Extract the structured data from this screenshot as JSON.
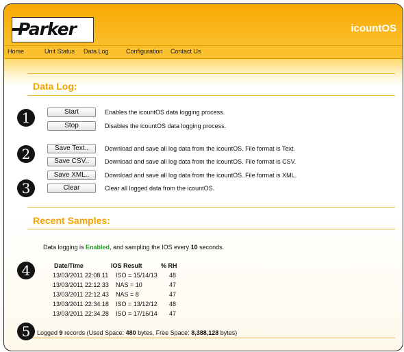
{
  "header": {
    "logo_text": "Parker",
    "app_title": "icountOS",
    "brand_color": "#f7a800"
  },
  "nav": {
    "items": [
      "Home",
      "Unit Status",
      "Data Log",
      "Configuration",
      "Contact Us"
    ]
  },
  "data_log": {
    "title": "Data Log:",
    "actions": [
      {
        "label": "Start",
        "description": "Enables the icountOS data logging process."
      },
      {
        "label": "Stop",
        "description": "Disables the icountOS data logging process."
      },
      {
        "label": "Save Text..",
        "description": "Download and save all log data from the icountOS. File format is Text."
      },
      {
        "label": "Save CSV..",
        "description": "Download and save all log data from the icountOS. File format is CSV."
      },
      {
        "label": "Save XML..",
        "description": "Download and save all log data from the icountOS. File format is XML."
      },
      {
        "label": "Clear",
        "description": "Clear all logged data from the icountOS."
      }
    ]
  },
  "markers": [
    "1",
    "2",
    "3",
    "4",
    "5"
  ],
  "recent": {
    "title": "Recent Samples:",
    "status_prefix": "Data logging is ",
    "status_value": "Enabled",
    "status_mid": ", and sampling the IOS every ",
    "interval": "10",
    "status_suffix": " seconds.",
    "status_color": "#2a9a2a",
    "columns": [
      "Date/Time",
      "IOS Result",
      "% RH"
    ],
    "rows": [
      [
        "13/03/2011 22:08.11",
        "ISO = 15/14/13",
        "48"
      ],
      [
        "13/03/2011 22:12.33",
        "NAS = 10",
        "47"
      ],
      [
        "13/03/2011 22:12.43",
        "NAS = 8",
        "47"
      ],
      [
        "13/03/2011 22:34.18",
        "ISO = 13/12/12",
        "48"
      ],
      [
        "13/03/2011 22:34.28",
        "ISO = 17/16/14",
        "47"
      ]
    ],
    "summary_prefix": "Logged ",
    "record_count": "9",
    "summary_mid1": " records (Used Space: ",
    "used_space": "480",
    "summary_mid2": " bytes, Free Space: ",
    "free_space": "8,388,128",
    "summary_suffix": " bytes)"
  }
}
